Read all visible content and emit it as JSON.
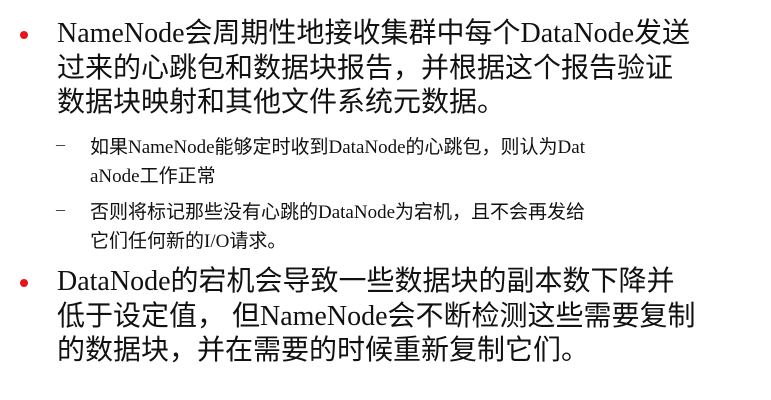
{
  "accent_color": "#e8141c",
  "bullets": [
    {
      "lines": [
        "NameNode会周期性地接收集群中每个DataNode发送",
        "过来的心跳包和数据块报告，并根据这个报告验证",
        "数据块映射和其他文件系统元数据。"
      ],
      "subitems": [
        {
          "marker": "–",
          "lines": [
            "如果NameNode能够定时收到DataNode的心跳包，则认为Dat",
            "aNode工作正常"
          ]
        },
        {
          "marker": "–",
          "lines": [
            "否则将标记那些没有心跳的DataNode为宕机，且不会再发给",
            "它们任何新的I/O请求。"
          ]
        }
      ]
    },
    {
      "lines": [
        "DataNode的宕机会导致一些数据块的副本数下降并",
        "低于设定值， 但NameNode会不断检测这些需要复制",
        "的数据块，并在需要的时候重新复制它们。"
      ]
    }
  ]
}
